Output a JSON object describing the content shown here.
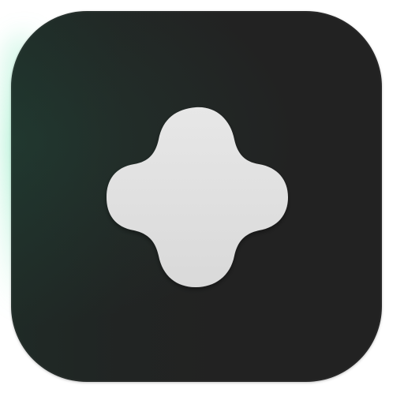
{
  "icon": {
    "symbol": "rounded-four-lobed-cross-icon",
    "tile_color": "#222222",
    "glyph_color": "#e2e2e2",
    "accent_glow_color": "#3cdc96"
  }
}
